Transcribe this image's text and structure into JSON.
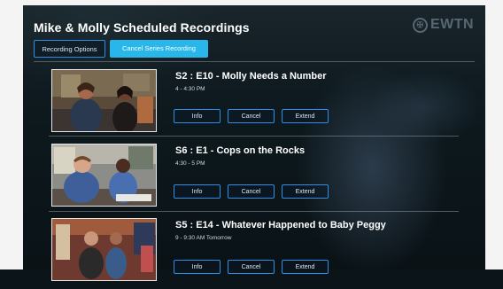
{
  "page": {
    "title": "Mike & Molly Scheduled Recordings",
    "logo_text": "EWTN"
  },
  "toolbar": {
    "recording_options_label": "Recording Options",
    "cancel_series_label": "Cancel Series Recording"
  },
  "recordings": [
    {
      "title": "S2 : E10 - Molly Needs a Number",
      "time": "4 - 4:30 PM",
      "info_label": "Info",
      "cancel_label": "Cancel",
      "extend_label": "Extend"
    },
    {
      "title": "S6 : E1 - Cops on the Rocks",
      "time": "4:30 - 5 PM",
      "info_label": "Info",
      "cancel_label": "Cancel",
      "extend_label": "Extend"
    },
    {
      "title": "S5 : E14 - Whatever Happened to Baby Peggy",
      "time": "9 - 9:30 AM Tomorrow",
      "info_label": "Info",
      "cancel_label": "Cancel",
      "extend_label": "Extend"
    }
  ],
  "colors": {
    "accent": "#29b6ea",
    "button_border": "#2d8ee6"
  }
}
